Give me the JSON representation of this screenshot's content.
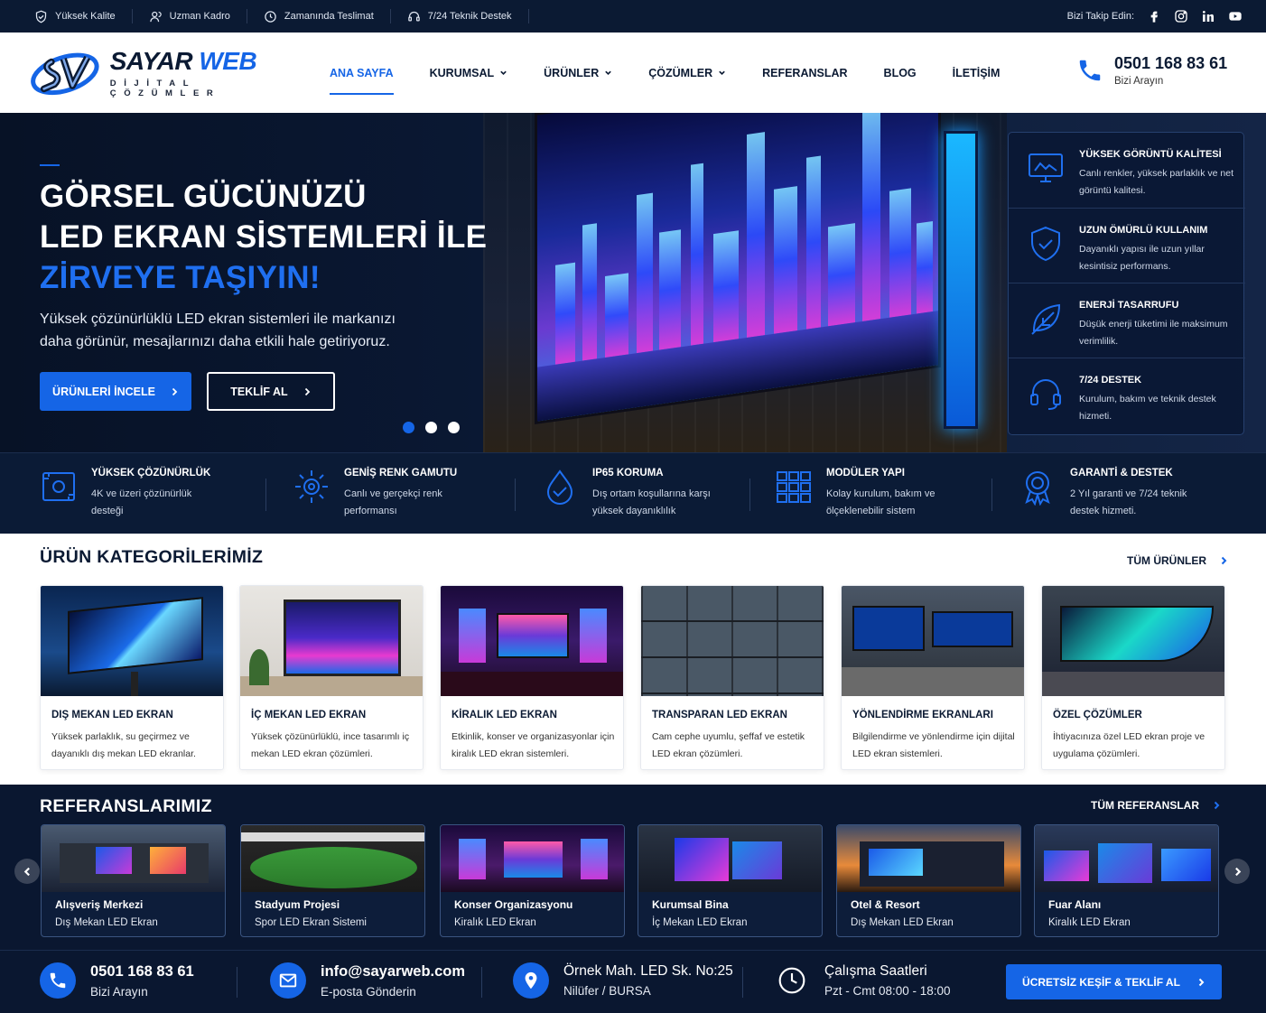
{
  "topbar": {
    "items": [
      "Yüksek Kalite",
      "Uzman Kadro",
      "Zamanında Teslimat",
      "7/24 Teknik Destek"
    ],
    "follow_label": "Bizi Takip Edin:",
    "socials": [
      "facebook-icon",
      "instagram-icon",
      "linkedin-icon",
      "youtube-icon"
    ]
  },
  "logo": {
    "title_a": "SAYAR ",
    "title_b": "WEB",
    "subtitle": "DİJİTAL ÇÖZÜMLER"
  },
  "nav": {
    "items": [
      {
        "label": "ANA SAYFA",
        "active": true
      },
      {
        "label": "KURUMSAL",
        "dropdown": true
      },
      {
        "label": "ÜRÜNLER",
        "dropdown": true
      },
      {
        "label": "ÇÖZÜMLER",
        "dropdown": true
      },
      {
        "label": "REFERANSLAR"
      },
      {
        "label": "BLOG"
      },
      {
        "label": "İLETİŞİM"
      }
    ]
  },
  "header_phone": {
    "number": "0501 168 83 61",
    "label": "Bizi Arayın"
  },
  "hero": {
    "line1": "GÖRSEL GÜCÜNÜZÜ",
    "line2": "LED EKRAN SİSTEMLERİ İLE",
    "line3": "ZİRVEYE TAŞIYIN!",
    "description": "Yüksek çözünürlüklü LED ekran sistemleri ile markanızı daha görünür, mesajlarınızı daha etkili hale getiriyoruz.",
    "primary_button": "ÜRÜNLERİ İNCELE",
    "secondary_button": "TEKLİF AL",
    "slides": 3,
    "active_slide": 1
  },
  "hero_features": [
    {
      "title": "YÜKSEK GÖRÜNTÜ KALİTESİ",
      "desc": "Canlı renkler, yüksek parlaklık ve net görüntü kalitesi.",
      "icon": "monitor-icon"
    },
    {
      "title": "UZUN ÖMÜRLÜ KULLANIM",
      "desc": "Dayanıklı yapısı ile uzun yıllar kesintisiz performans.",
      "icon": "shield-check-icon"
    },
    {
      "title": "ENERJİ TASARRUFU",
      "desc": "Düşük enerji tüketimi ile maksimum verimlilik.",
      "icon": "leaf-icon"
    },
    {
      "title": "7/24 DESTEK",
      "desc": "Kurulum, bakım ve teknik destek hizmeti.",
      "icon": "headset-icon"
    }
  ],
  "strip": [
    {
      "title": "YÜKSEK ÇÖZÜNÜRLÜK",
      "desc": "4K ve üzeri çözünürlük desteği",
      "icon": "resolution-icon"
    },
    {
      "title": "GENİŞ RENK GAMUTU",
      "desc": "Canlı ve gerçekçi renk performansı",
      "icon": "sun-icon"
    },
    {
      "title": "IP65 KORUMA",
      "desc": "Dış ortam koşullarına karşı yüksek dayanıklılık",
      "icon": "water-drop-icon"
    },
    {
      "title": "MODÜLER YAPI",
      "desc": "Kolay kurulum, bakım ve ölçeklenebilir sistem",
      "icon": "grid-icon"
    },
    {
      "title": "GARANTİ & DESTEK",
      "desc": "2 Yıl garanti ve 7/24 teknik destek hizmeti.",
      "icon": "award-icon"
    }
  ],
  "categories": {
    "title": "ÜRÜN KATEGORİLERİMİZ",
    "link": "TÜM ÜRÜNLER",
    "items": [
      {
        "title": "DIŞ MEKAN LED EKRAN",
        "desc": "Yüksek parlaklık, su geçirmez ve dayanıklı dış mekan LED ekranlar."
      },
      {
        "title": "İÇ MEKAN LED EKRAN",
        "desc": "Yüksek çözünürlüklü, ince tasarımlı iç mekan LED ekran çözümleri."
      },
      {
        "title": "KİRALIK LED EKRAN",
        "desc": "Etkinlik, konser ve organizasyonlar için kiralık LED ekran sistemleri."
      },
      {
        "title": "TRANSPARAN LED EKRAN",
        "desc": "Cam cephe uyumlu, şeffaf ve estetik LED ekran çözümleri."
      },
      {
        "title": "YÖNLENDİRME EKRANLARI",
        "desc": "Bilgilendirme ve yönlendirme için dijital LED ekran sistemleri."
      },
      {
        "title": "ÖZEL ÇÖZÜMLER",
        "desc": "İhtiyacınıza özel LED ekran proje ve uygulama çözümleri."
      }
    ]
  },
  "references": {
    "title": "REFERANSLARIMIZ",
    "link": "TÜM REFERANSLAR",
    "items": [
      {
        "title": "Alışveriş Merkezi",
        "desc": "Dış Mekan LED Ekran"
      },
      {
        "title": "Stadyum Projesi",
        "desc": "Spor LED Ekran Sistemi"
      },
      {
        "title": "Konser Organizasyonu",
        "desc": "Kiralık LED Ekran"
      },
      {
        "title": "Kurumsal Bina",
        "desc": "İç Mekan LED Ekran"
      },
      {
        "title": "Otel & Resort",
        "desc": "Dış Mekan LED Ekran"
      },
      {
        "title": "Fuar Alanı",
        "desc": "Kiralık LED Ekran"
      }
    ]
  },
  "contact": {
    "phone": "0501 168 83 61",
    "phone_label": "Bizi Arayın",
    "email": "info@sayarweb.com",
    "email_label": "E-posta Gönderin",
    "address_1": "Örnek Mah. LED Sk. No:25",
    "address_2": "Nilüfer / BURSA",
    "hours_title": "Çalışma Saatleri",
    "hours": "Pzt - Cmt 08:00 - 18:00",
    "cta": "ÜCRETSİZ KEŞİF & TEKLİF AL"
  },
  "colors": {
    "brand_blue": "#1565e6",
    "navy": "#0a1730",
    "white": "#ffffff"
  }
}
